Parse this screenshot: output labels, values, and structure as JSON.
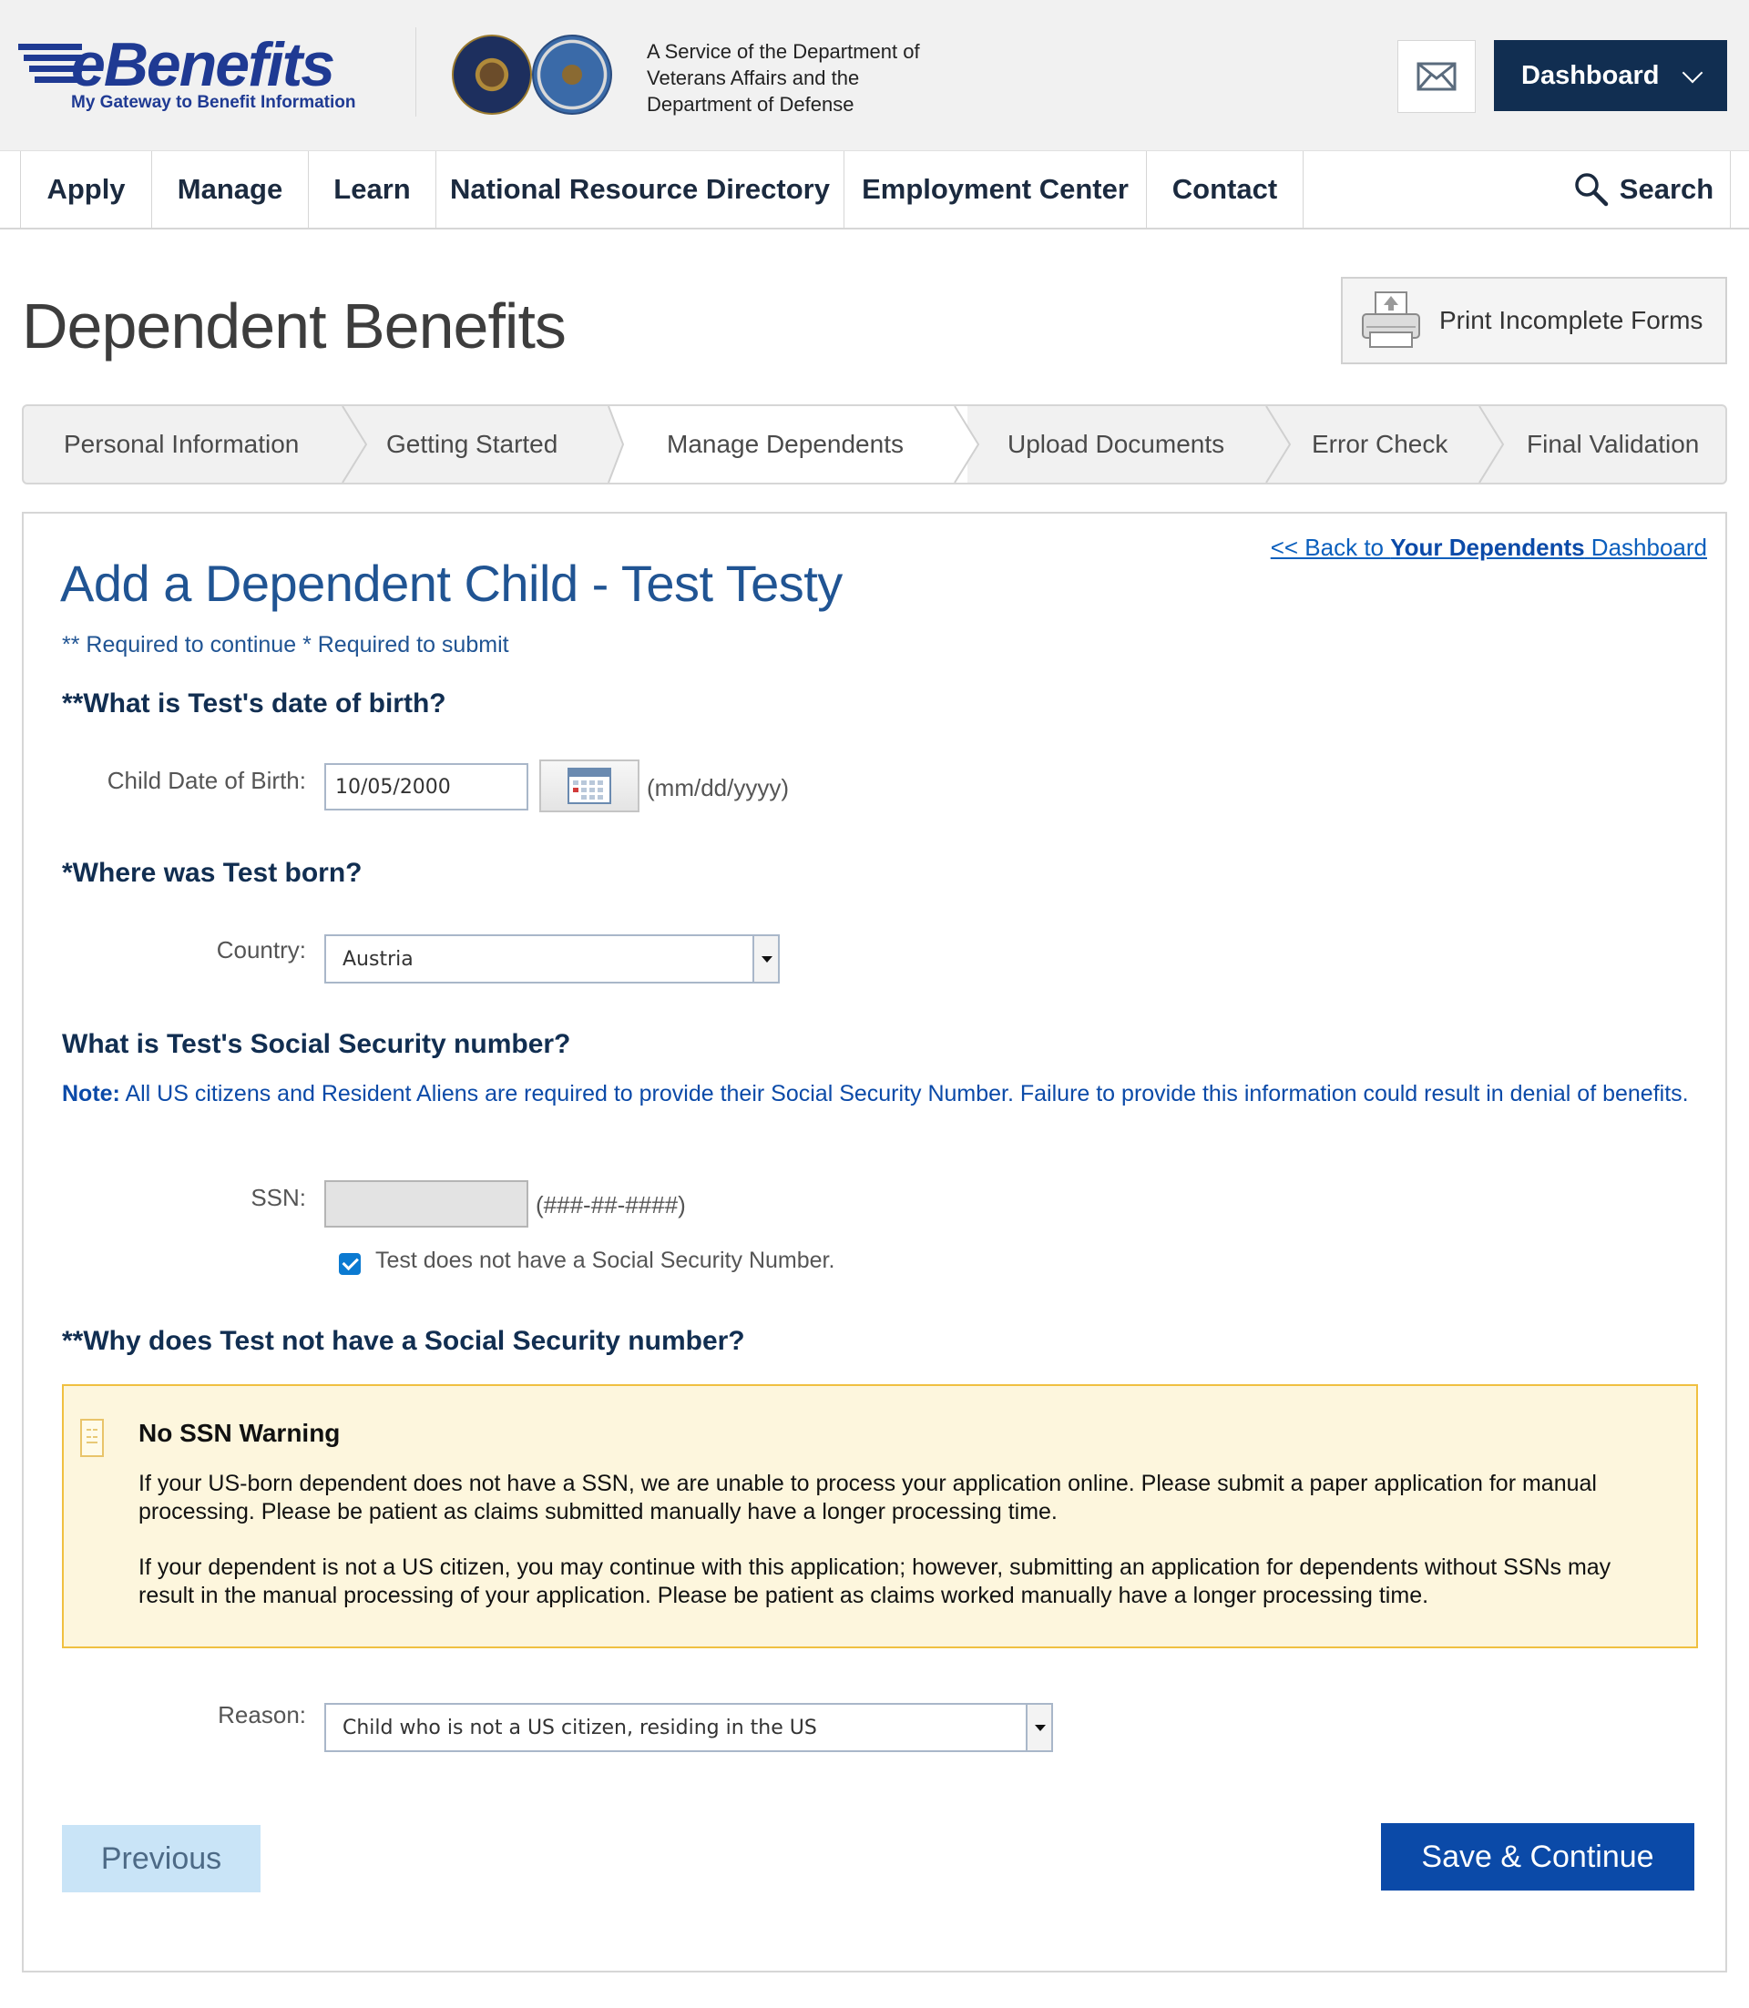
{
  "header": {
    "logo_text": "eBenefits",
    "logo_tagline": "My Gateway to Benefit Information",
    "service_text": "A Service of the Department of Veterans Affairs and the Department of Defense",
    "dashboard_label": "Dashboard"
  },
  "nav": {
    "items": [
      "Apply",
      "Manage",
      "Learn",
      "National Resource Directory",
      "Employment Center",
      "Contact"
    ],
    "search_label": "Search"
  },
  "page": {
    "title": "Dependent Benefits",
    "print_label": "Print Incomplete Forms"
  },
  "steps": [
    "Personal Information",
    "Getting Started",
    "Manage Dependents",
    "Upload Documents",
    "Error Check",
    "Final Validation"
  ],
  "form": {
    "back_prefix": "<< Back to ",
    "back_bold": "Your Dependents",
    "back_suffix": " Dashboard",
    "title": "Add a Dependent Child - Test Testy",
    "required_note": "** Required to continue * Required to submit",
    "q_dob": "**What is Test's date of birth?",
    "dob_label": "Child Date of Birth:",
    "dob_value": "10/05/2000",
    "dob_hint": "(mm/dd/yyyy)",
    "q_born": "*Where was Test born?",
    "country_label": "Country:",
    "country_value": "Austria",
    "q_ssn": "What is Test's Social Security number?",
    "note_bold": "Note:",
    "note_text": " All US citizens and Resident Aliens are required to provide their Social Security Number. Failure to provide this information could result in denial of benefits.",
    "ssn_label": "SSN:",
    "ssn_value": "",
    "ssn_hint": "(###-##-####)",
    "no_ssn_checkbox": "Test does not have a Social Security Number.",
    "no_ssn_checked": true,
    "q_why": "**Why does Test not have a Social Security number?",
    "warning_title": "No SSN Warning",
    "warning_p1": "If your US-born dependent does not have a SSN, we are unable to process your application online. Please submit a paper application for manual processing. Please be patient as claims submitted manually have a longer processing time.",
    "warning_p2": "If your dependent is not a US citizen, you may continue with this application; however, submitting an application for dependents without SSNs may result in the manual processing of your application. Please be patient as claims worked manually have a longer processing time.",
    "reason_label": "Reason:",
    "reason_value": "Child who is not a US citizen, residing in the US",
    "previous_label": "Previous",
    "save_label": "Save & Continue"
  },
  "colors": {
    "navy": "#112e51",
    "link_blue": "#0b4aa8",
    "title_blue": "#205493",
    "warning_bg": "#fdf6dd",
    "warning_border": "#f0c040"
  }
}
